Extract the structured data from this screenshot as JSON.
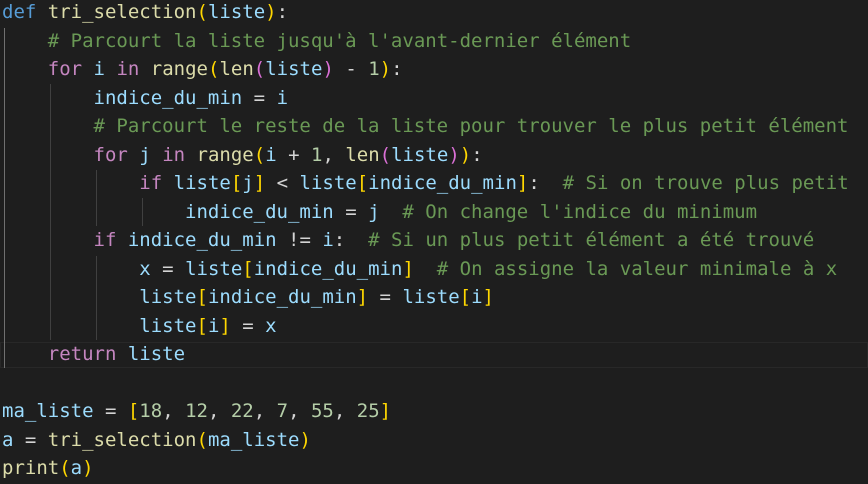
{
  "editor": {
    "language": "python",
    "theme": "dark",
    "token_colors": {
      "keyword": "#569cd6",
      "control": "#c586c0",
      "function": "#dcdcaa",
      "variable": "#9cdcfe",
      "number": "#b5cea8",
      "comment": "#6a9955",
      "bracket_level_1": "#ffd700",
      "bracket_level_2": "#da70d6",
      "bracket_level_3": "#179fff"
    },
    "lines": [
      [
        [
          "kw",
          "def"
        ],
        [
          "op",
          " "
        ],
        [
          "fn",
          "tri_selection"
        ],
        [
          "b1",
          "("
        ],
        [
          "var",
          "liste"
        ],
        [
          "b1",
          ")"
        ],
        [
          "op",
          ":"
        ]
      ],
      [
        [
          "op",
          "    "
        ],
        [
          "cmt",
          "# Parcourt la liste jusqu'à l'avant-dernier élément"
        ]
      ],
      [
        [
          "op",
          "    "
        ],
        [
          "ctl",
          "for"
        ],
        [
          "op",
          " "
        ],
        [
          "var",
          "i"
        ],
        [
          "op",
          " "
        ],
        [
          "ctl",
          "in"
        ],
        [
          "op",
          " "
        ],
        [
          "fn",
          "range"
        ],
        [
          "b1",
          "("
        ],
        [
          "fn",
          "len"
        ],
        [
          "b2",
          "("
        ],
        [
          "var",
          "liste"
        ],
        [
          "b2",
          ")"
        ],
        [
          "op",
          " - "
        ],
        [
          "num",
          "1"
        ],
        [
          "b1",
          ")"
        ],
        [
          "op",
          ":"
        ]
      ],
      [
        [
          "op",
          "        "
        ],
        [
          "var",
          "indice_du_min"
        ],
        [
          "op",
          " = "
        ],
        [
          "var",
          "i"
        ]
      ],
      [
        [
          "op",
          "        "
        ],
        [
          "cmt",
          "# Parcourt le reste de la liste pour trouver le plus petit élément"
        ]
      ],
      [
        [
          "op",
          "        "
        ],
        [
          "ctl",
          "for"
        ],
        [
          "op",
          " "
        ],
        [
          "var",
          "j"
        ],
        [
          "op",
          " "
        ],
        [
          "ctl",
          "in"
        ],
        [
          "op",
          " "
        ],
        [
          "fn",
          "range"
        ],
        [
          "b1",
          "("
        ],
        [
          "var",
          "i"
        ],
        [
          "op",
          " + "
        ],
        [
          "num",
          "1"
        ],
        [
          "op",
          ", "
        ],
        [
          "fn",
          "len"
        ],
        [
          "b2",
          "("
        ],
        [
          "var",
          "liste"
        ],
        [
          "b2",
          ")"
        ],
        [
          "b1",
          ")"
        ],
        [
          "op",
          ":"
        ]
      ],
      [
        [
          "op",
          "            "
        ],
        [
          "ctl",
          "if"
        ],
        [
          "op",
          " "
        ],
        [
          "var",
          "liste"
        ],
        [
          "b1",
          "["
        ],
        [
          "var",
          "j"
        ],
        [
          "b1",
          "]"
        ],
        [
          "op",
          " < "
        ],
        [
          "var",
          "liste"
        ],
        [
          "b1",
          "["
        ],
        [
          "var",
          "indice_du_min"
        ],
        [
          "b1",
          "]"
        ],
        [
          "op",
          ":  "
        ],
        [
          "cmt",
          "# Si on trouve plus petit"
        ]
      ],
      [
        [
          "op",
          "                "
        ],
        [
          "var",
          "indice_du_min"
        ],
        [
          "op",
          " = "
        ],
        [
          "var",
          "j"
        ],
        [
          "op",
          "  "
        ],
        [
          "cmt",
          "# On change l'indice du minimum"
        ]
      ],
      [
        [
          "op",
          "        "
        ],
        [
          "ctl",
          "if"
        ],
        [
          "op",
          " "
        ],
        [
          "var",
          "indice_du_min"
        ],
        [
          "op",
          " != "
        ],
        [
          "var",
          "i"
        ],
        [
          "op",
          ":  "
        ],
        [
          "cmt",
          "# Si un plus petit élément a été trouvé"
        ]
      ],
      [
        [
          "op",
          "            "
        ],
        [
          "var",
          "x"
        ],
        [
          "op",
          " = "
        ],
        [
          "var",
          "liste"
        ],
        [
          "b1",
          "["
        ],
        [
          "var",
          "indice_du_min"
        ],
        [
          "b1",
          "]"
        ],
        [
          "op",
          "  "
        ],
        [
          "cmt",
          "# On assigne la valeur minimale à x"
        ]
      ],
      [
        [
          "op",
          "            "
        ],
        [
          "var",
          "liste"
        ],
        [
          "b1",
          "["
        ],
        [
          "var",
          "indice_du_min"
        ],
        [
          "b1",
          "]"
        ],
        [
          "op",
          " = "
        ],
        [
          "var",
          "liste"
        ],
        [
          "b1",
          "["
        ],
        [
          "var",
          "i"
        ],
        [
          "b1",
          "]"
        ]
      ],
      [
        [
          "op",
          "            "
        ],
        [
          "var",
          "liste"
        ],
        [
          "b1",
          "["
        ],
        [
          "var",
          "i"
        ],
        [
          "b1",
          "]"
        ],
        [
          "op",
          " = "
        ],
        [
          "var",
          "x"
        ]
      ],
      [
        [
          "op",
          "    "
        ],
        [
          "ctl",
          "return"
        ],
        [
          "op",
          " "
        ],
        [
          "var",
          "liste"
        ]
      ],
      [],
      [
        [
          "var",
          "ma_liste"
        ],
        [
          "op",
          " = "
        ],
        [
          "b1",
          "["
        ],
        [
          "num",
          "18"
        ],
        [
          "op",
          ", "
        ],
        [
          "num",
          "12"
        ],
        [
          "op",
          ", "
        ],
        [
          "num",
          "22"
        ],
        [
          "op",
          ", "
        ],
        [
          "num",
          "7"
        ],
        [
          "op",
          ", "
        ],
        [
          "num",
          "55"
        ],
        [
          "op",
          ", "
        ],
        [
          "num",
          "25"
        ],
        [
          "b1",
          "]"
        ]
      ],
      [
        [
          "var",
          "a"
        ],
        [
          "op",
          " = "
        ],
        [
          "fn",
          "tri_selection"
        ],
        [
          "b1",
          "("
        ],
        [
          "var",
          "ma_liste"
        ],
        [
          "b1",
          ")"
        ]
      ],
      [
        [
          "fn",
          "print"
        ],
        [
          "b1",
          "("
        ],
        [
          "var",
          "a"
        ],
        [
          "b1",
          ")"
        ]
      ]
    ]
  }
}
